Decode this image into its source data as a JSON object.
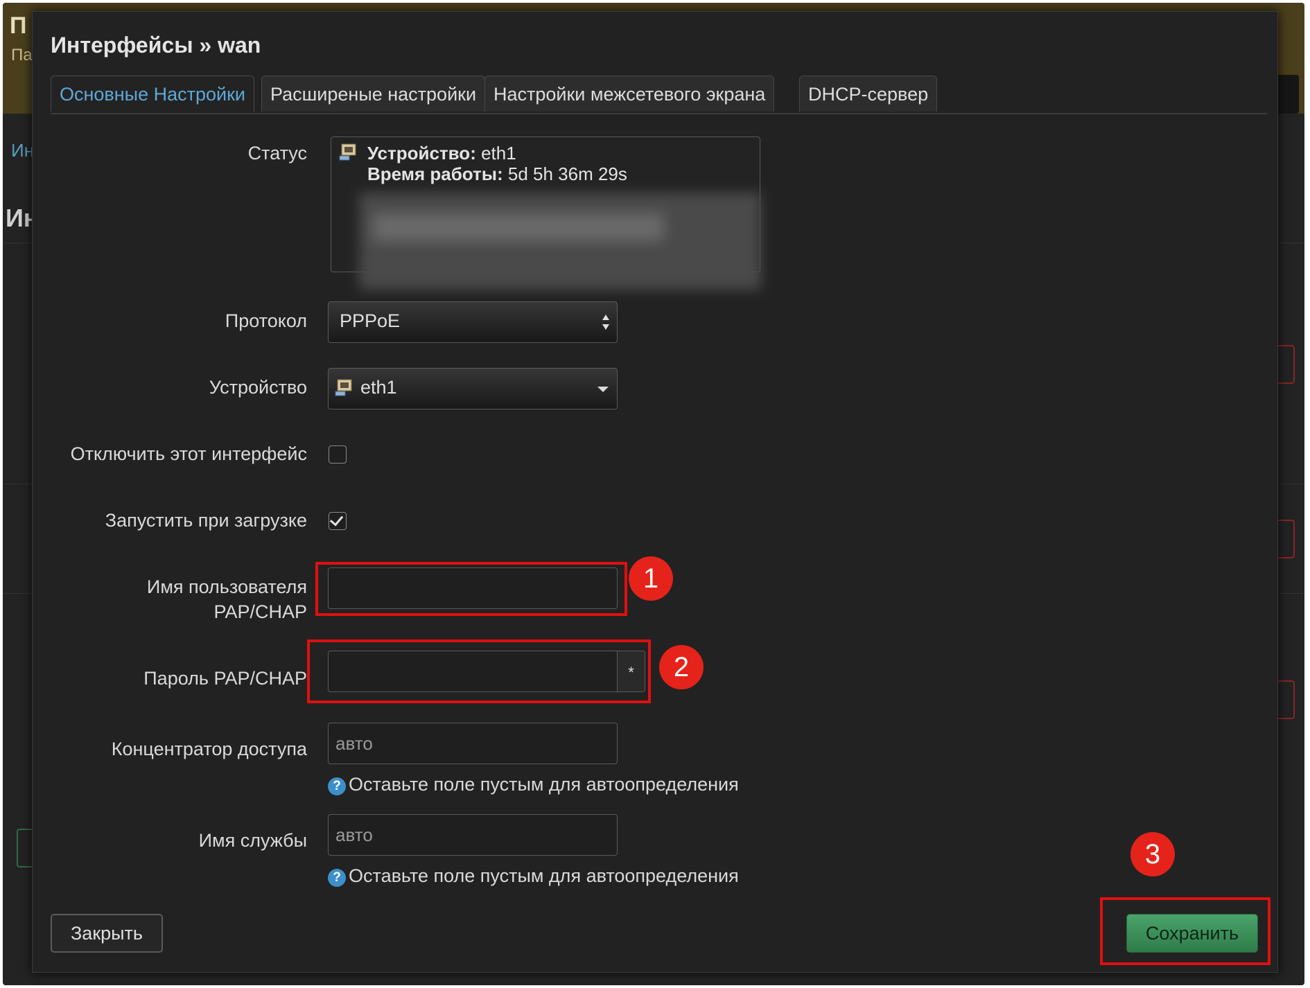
{
  "background": {
    "top_title_fragment": "П",
    "top_subtitle_fragment": "Па",
    "breadcrumb_fragment": "Ин",
    "heading_fragment": "Ин"
  },
  "modal": {
    "title": "Интерфейсы » wan",
    "tabs": [
      {
        "label": "Основные Настройки",
        "active": true
      },
      {
        "label": "Расширеные настройки",
        "active": false
      },
      {
        "label": "Настройки межсетевого экрана",
        "active": false
      },
      {
        "label": "DHCP-сервер",
        "active": false
      }
    ],
    "fields": {
      "status": {
        "label": "Статус",
        "device_key": "Устройство:",
        "device_value": " eth1",
        "uptime_key": "Время работы:",
        "uptime_value": " 5d 5h 36m 29s",
        "icon": "network-port-icon"
      },
      "protocol": {
        "label": "Протокол",
        "value": "PPPoE"
      },
      "device": {
        "label": "Устройство",
        "value": "eth1",
        "icon": "network-port-icon"
      },
      "disable_interface": {
        "label": "Отключить этот интерфейс",
        "checked": false
      },
      "start_on_boot": {
        "label": "Запустить при загрузке",
        "checked": true
      },
      "username": {
        "label_line1": "Имя пользователя",
        "label_line2": "PAP/CHAP",
        "value": ""
      },
      "password": {
        "label": "Пароль PAP/CHAP",
        "value": "",
        "reveal_button": "*"
      },
      "access_concentrator": {
        "label": "Концентратор доступа",
        "placeholder": "авто",
        "help": "Оставьте поле пустым для автоопределения"
      },
      "service_name": {
        "label": "Имя службы",
        "placeholder": "авто",
        "help": "Оставьте поле пустым для автоопределения"
      }
    },
    "buttons": {
      "close": "Закрыть",
      "save": "Сохранить"
    },
    "annotations": {
      "badge1": "1",
      "badge2": "2",
      "badge3": "3",
      "highlight_color": "#e01010",
      "badge_color": "#e5231b"
    },
    "help_icon": "?"
  },
  "colors": {
    "modal_bg": "#222222",
    "active_tab": "#5ea8d6",
    "save_button": "#3e9a5e"
  }
}
